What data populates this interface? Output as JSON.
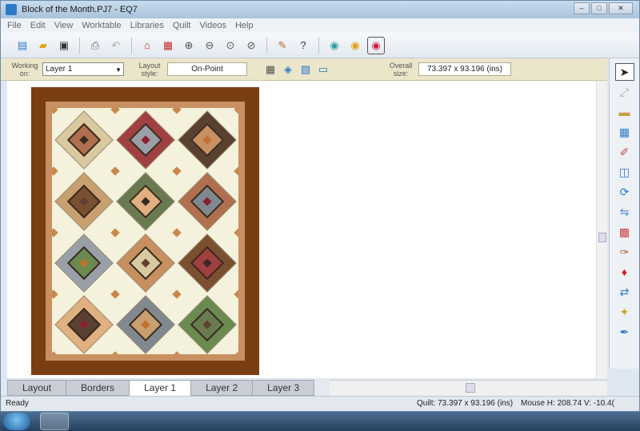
{
  "window": {
    "title": "Block of the Month.PJ7 - EQ7"
  },
  "menu": [
    "File",
    "Edit",
    "View",
    "Worktable",
    "Libraries",
    "Quilt",
    "Videos",
    "Help"
  ],
  "propbar": {
    "working_on_label": "Working on:",
    "working_on_value": "Layer 1",
    "layout_style_label": "Layout style:",
    "layout_style_value": "On-Point",
    "overall_size_label": "Overall size:",
    "overall_size_value": "73.397 x 93.196 (ins)"
  },
  "tabs": [
    "Layout",
    "Borders",
    "Layer 1",
    "Layer 2",
    "Layer 3"
  ],
  "active_tab": "Layer 1",
  "status": {
    "left": "Ready",
    "quilt": "Quilt: 73.397 x 93.196 (ins)",
    "mouse": "Mouse  H: 208.74  V: -10.4("
  },
  "colors": {
    "outer_border": "#7a3e14",
    "inner_border": "#c89060",
    "background": "#f4f1dc",
    "accent": "#2d7ac8"
  },
  "icons": {
    "toolbar": [
      "new-icon",
      "open-icon",
      "save-icon",
      "print-icon",
      "undo-icon",
      "house-icon",
      "layout-icon",
      "zoom-in-icon",
      "zoom-out-icon",
      "zoom-fit-icon",
      "zoom-page-icon",
      "sketch-icon",
      "hint-icon",
      "worktable-quilt-icon",
      "worktable-block-icon",
      "worktable-image-icon"
    ],
    "right": [
      "pick-icon",
      "adjust-icon",
      "ruler-icon",
      "set-block-icon",
      "erase-icon",
      "symmetry-icon",
      "rotate-icon",
      "flip-icon",
      "color-icon",
      "paintbrush-icon",
      "spraycan-icon",
      "swap-icon",
      "magic-wand-icon",
      "eyedropper-icon"
    ]
  }
}
